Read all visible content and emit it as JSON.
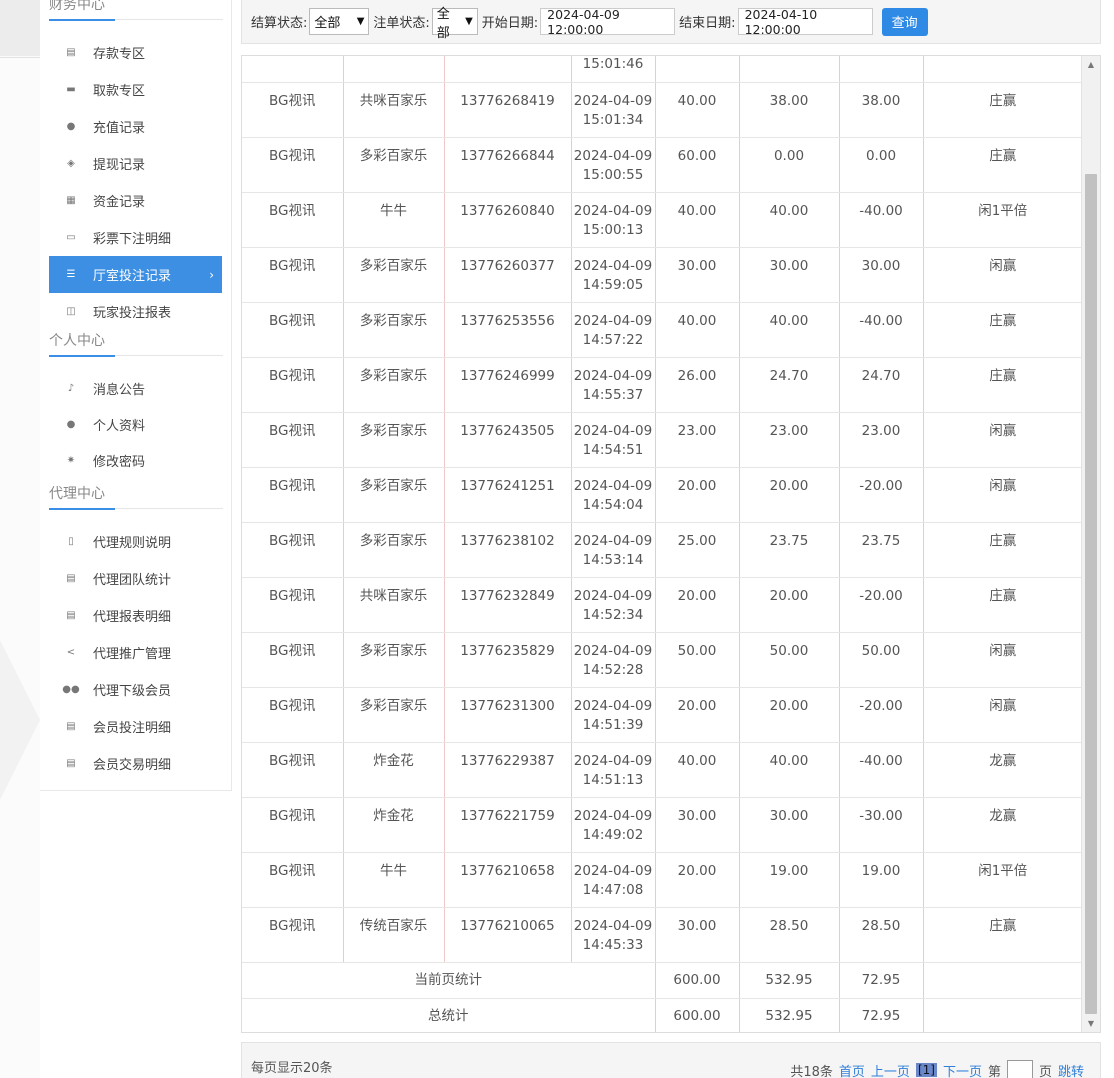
{
  "sidebar": {
    "finance_title": "财务中心",
    "finance_items": [
      {
        "label": "存款专区",
        "icon": "deposit-icon"
      },
      {
        "label": "取款专区",
        "icon": "withdraw-icon"
      },
      {
        "label": "充值记录",
        "icon": "moneybag-icon"
      },
      {
        "label": "提现记录",
        "icon": "wallet-icon"
      },
      {
        "label": "资金记录",
        "icon": "bank-icon"
      },
      {
        "label": "彩票下注明细",
        "icon": "list-icon"
      },
      {
        "label": "厅室投注记录",
        "icon": "grid-list-icon"
      },
      {
        "label": "玩家投注报表",
        "icon": "chart-icon"
      }
    ],
    "personal_title": "个人中心",
    "personal_items": [
      {
        "label": "消息公告",
        "icon": "bell-icon"
      },
      {
        "label": "个人资料",
        "icon": "user-icon"
      },
      {
        "label": "修改密码",
        "icon": "gear-icon"
      }
    ],
    "agent_title": "代理中心",
    "agent_items": [
      {
        "label": "代理规则说明",
        "icon": "document-icon"
      },
      {
        "label": "代理团队统计",
        "icon": "table-icon"
      },
      {
        "label": "代理报表明细",
        "icon": "table-icon"
      },
      {
        "label": "代理推广管理",
        "icon": "share-icon"
      },
      {
        "label": "代理下级会员",
        "icon": "users-icon"
      },
      {
        "label": "会员投注明细",
        "icon": "receipt-icon"
      },
      {
        "label": "会员交易明细",
        "icon": "ledger-icon"
      }
    ],
    "active_index": 6,
    "accent": "#3c8fe2"
  },
  "filter": {
    "settle_label": "结算状态:",
    "settle_value": "全部",
    "bet_label": "注单状态:",
    "bet_value": "全部",
    "start_label": "开始日期:",
    "start_value": "2024-04-09 12:00:00",
    "end_label": "结束日期:",
    "end_value": "2024-04-10 12:00:00",
    "query_button": "查询"
  },
  "table": {
    "partial_row_time": "15:01:46",
    "rows": [
      {
        "platform": "BG视讯",
        "game": "共咪百家乐",
        "order": "13776268419",
        "date": "2024-04-09",
        "time": "15:01:34",
        "bet": "40.00",
        "valid": "38.00",
        "winloss": "38.00",
        "result": "庄赢"
      },
      {
        "platform": "BG视讯",
        "game": "多彩百家乐",
        "order": "13776266844",
        "date": "2024-04-09",
        "time": "15:00:55",
        "bet": "60.00",
        "valid": "0.00",
        "winloss": "0.00",
        "result": "庄赢"
      },
      {
        "platform": "BG视讯",
        "game": "牛牛",
        "order": "13776260840",
        "date": "2024-04-09",
        "time": "15:00:13",
        "bet": "40.00",
        "valid": "40.00",
        "winloss": "-40.00",
        "result": "闲1平倍"
      },
      {
        "platform": "BG视讯",
        "game": "多彩百家乐",
        "order": "13776260377",
        "date": "2024-04-09",
        "time": "14:59:05",
        "bet": "30.00",
        "valid": "30.00",
        "winloss": "30.00",
        "result": "闲赢"
      },
      {
        "platform": "BG视讯",
        "game": "多彩百家乐",
        "order": "13776253556",
        "date": "2024-04-09",
        "time": "14:57:22",
        "bet": "40.00",
        "valid": "40.00",
        "winloss": "-40.00",
        "result": "庄赢"
      },
      {
        "platform": "BG视讯",
        "game": "多彩百家乐",
        "order": "13776246999",
        "date": "2024-04-09",
        "time": "14:55:37",
        "bet": "26.00",
        "valid": "24.70",
        "winloss": "24.70",
        "result": "庄赢"
      },
      {
        "platform": "BG视讯",
        "game": "多彩百家乐",
        "order": "13776243505",
        "date": "2024-04-09",
        "time": "14:54:51",
        "bet": "23.00",
        "valid": "23.00",
        "winloss": "23.00",
        "result": "闲赢"
      },
      {
        "platform": "BG视讯",
        "game": "多彩百家乐",
        "order": "13776241251",
        "date": "2024-04-09",
        "time": "14:54:04",
        "bet": "20.00",
        "valid": "20.00",
        "winloss": "-20.00",
        "result": "闲赢"
      },
      {
        "platform": "BG视讯",
        "game": "多彩百家乐",
        "order": "13776238102",
        "date": "2024-04-09",
        "time": "14:53:14",
        "bet": "25.00",
        "valid": "23.75",
        "winloss": "23.75",
        "result": "庄赢"
      },
      {
        "platform": "BG视讯",
        "game": "共咪百家乐",
        "order": "13776232849",
        "date": "2024-04-09",
        "time": "14:52:34",
        "bet": "20.00",
        "valid": "20.00",
        "winloss": "-20.00",
        "result": "庄赢"
      },
      {
        "platform": "BG视讯",
        "game": "多彩百家乐",
        "order": "13776235829",
        "date": "2024-04-09",
        "time": "14:52:28",
        "bet": "50.00",
        "valid": "50.00",
        "winloss": "50.00",
        "result": "闲赢"
      },
      {
        "platform": "BG视讯",
        "game": "多彩百家乐",
        "order": "13776231300",
        "date": "2024-04-09",
        "time": "14:51:39",
        "bet": "20.00",
        "valid": "20.00",
        "winloss": "-20.00",
        "result": "闲赢"
      },
      {
        "platform": "BG视讯",
        "game": "炸金花",
        "order": "13776229387",
        "date": "2024-04-09",
        "time": "14:51:13",
        "bet": "40.00",
        "valid": "40.00",
        "winloss": "-40.00",
        "result": "龙赢"
      },
      {
        "platform": "BG视讯",
        "game": "炸金花",
        "order": "13776221759",
        "date": "2024-04-09",
        "time": "14:49:02",
        "bet": "30.00",
        "valid": "30.00",
        "winloss": "-30.00",
        "result": "龙赢"
      },
      {
        "platform": "BG视讯",
        "game": "牛牛",
        "order": "13776210658",
        "date": "2024-04-09",
        "time": "14:47:08",
        "bet": "20.00",
        "valid": "19.00",
        "winloss": "19.00",
        "result": "闲1平倍"
      },
      {
        "platform": "BG视讯",
        "game": "传统百家乐",
        "order": "13776210065",
        "date": "2024-04-09",
        "time": "14:45:33",
        "bet": "30.00",
        "valid": "28.50",
        "winloss": "28.50",
        "result": "庄赢"
      }
    ],
    "page_sum": {
      "label": "当前页统计",
      "bet": "600.00",
      "valid": "532.95",
      "winloss": "72.95"
    },
    "total_sum": {
      "label": "总统计",
      "bet": "600.00",
      "valid": "532.95",
      "winloss": "72.95"
    }
  },
  "pager": {
    "per_page": "每页显示20条",
    "total": "共18条",
    "first": "首页",
    "prev": "上一页",
    "current": "[1]",
    "next": "下一页",
    "goto_prefix": "第",
    "goto_suffix": "页",
    "jump": "跳转"
  }
}
